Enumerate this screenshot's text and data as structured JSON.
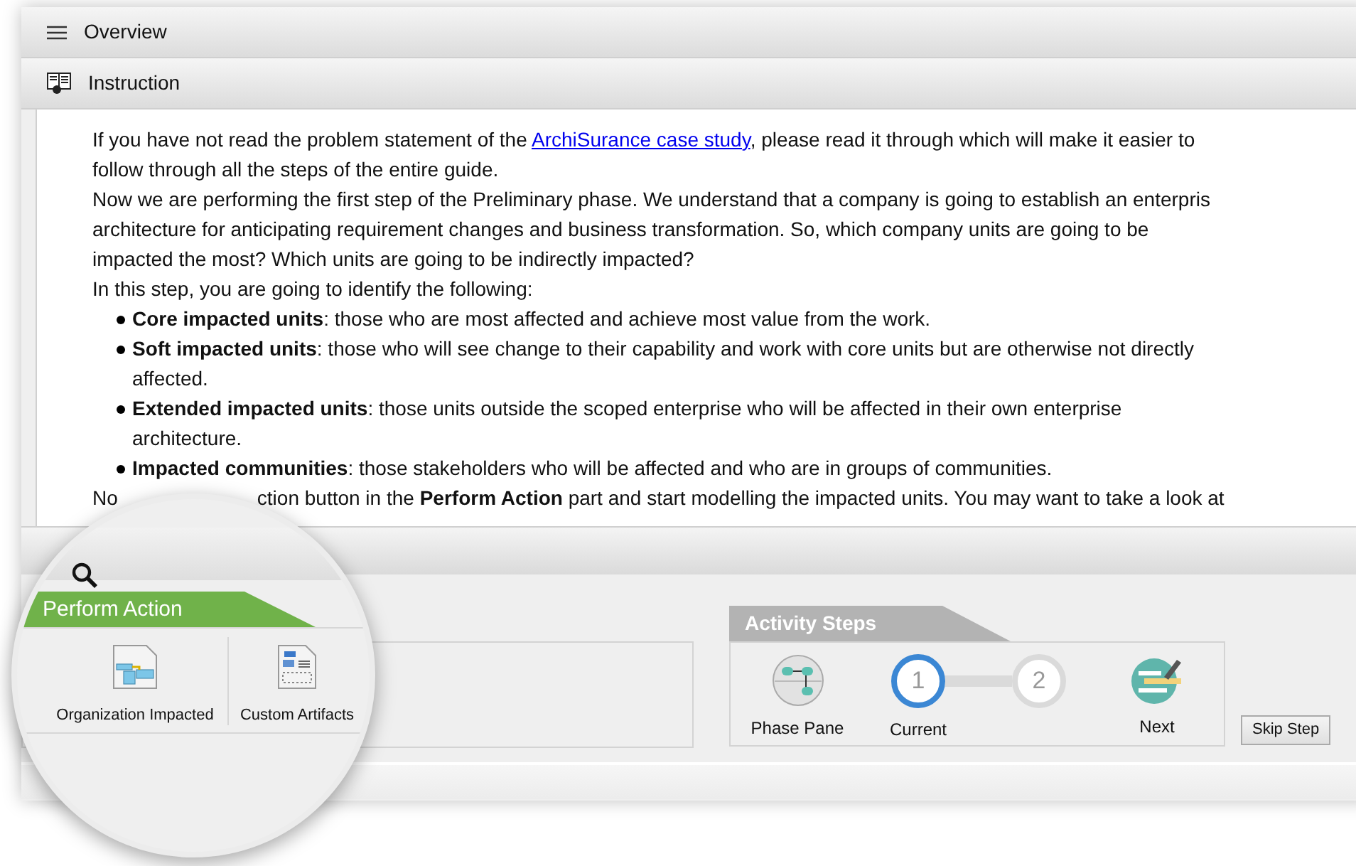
{
  "panels": [
    {
      "title": "Overview",
      "kind": "menu"
    },
    {
      "title": "Instruction",
      "kind": "book"
    }
  ],
  "instruction": {
    "lines": [
      {
        "kind": "link_line",
        "before": "If you have not read the problem statement of the ",
        "link": "ArchiSurance case study",
        "after": ", please read it through which will make it easier to"
      },
      {
        "kind": "text",
        "text": "follow through all the steps of the entire guide."
      },
      {
        "kind": "text",
        "text": "Now we are performing the first step of the Preliminary phase. We understand that a company is going to establish an enterpris"
      },
      {
        "kind": "text",
        "text": "architecture for anticipating requirement changes and business transformation. So, which company units are going to be"
      },
      {
        "kind": "text",
        "text": "impacted the most? Which units are going to be indirectly impacted?"
      },
      {
        "kind": "text",
        "text": "In this step, you are going to identify the following:"
      },
      {
        "kind": "bullet",
        "text": "**Core impacted units**: those who are most affected and achieve most value from the work."
      },
      {
        "kind": "bullet",
        "text": "**Soft impacted units**: those who will see change to their capability and work with core units but are otherwise not directly"
      },
      {
        "kind": "indent",
        "text": "affected."
      },
      {
        "kind": "bullet",
        "text": "**Extended impacted units**: those units outside the scoped enterprise who will be affected in their own enterprise"
      },
      {
        "kind": "indent",
        "text": "architecture."
      },
      {
        "kind": "bullet",
        "text": "**Impacted communities**: those stakeholders who will be affected and who are in groups of communities."
      },
      {
        "kind": "covered",
        "before": "No",
        "after": "ction button in the **Perform Action** part and start modelling the impacted units. You may want to take a look at"
      }
    ]
  },
  "perform_action": {
    "title": "Perform Action",
    "items": [
      {
        "kind": "diagram",
        "label": "Organization Impacted"
      },
      {
        "kind": "layout",
        "label": "Custom Artifacts"
      }
    ]
  },
  "activity_steps": {
    "title": "Activity Steps",
    "items": [
      {
        "kind": "phase",
        "label": "Phase Pane"
      },
      {
        "kind": "step",
        "number": "1",
        "label": "Current",
        "selected": true
      },
      {
        "kind": "step",
        "number": "2",
        "selected": false
      },
      {
        "kind": "next",
        "label": "Next"
      }
    ]
  },
  "buttons": [
    "Skip Step"
  ]
}
